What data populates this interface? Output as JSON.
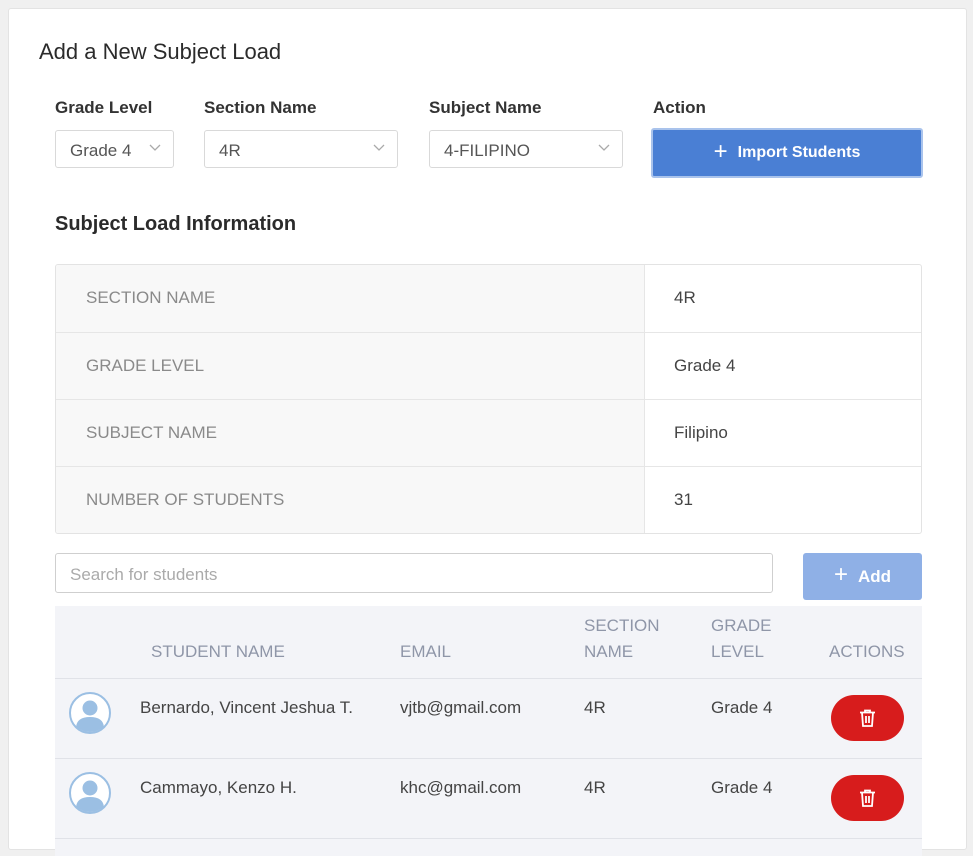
{
  "page_title": "Add a New Subject Load",
  "filters": {
    "grade_level": {
      "label": "Grade Level",
      "value": "Grade 4"
    },
    "section_name": {
      "label": "Section Name",
      "value": "4R"
    },
    "subject_name": {
      "label": "Subject Name",
      "value": "4-FILIPINO"
    },
    "action": {
      "label": "Action",
      "button": "Import Students"
    }
  },
  "info": {
    "heading": "Subject Load Information",
    "rows": [
      {
        "key": "SECTION NAME",
        "value": "4R"
      },
      {
        "key": "GRADE LEVEL",
        "value": "Grade 4"
      },
      {
        "key": "SUBJECT NAME",
        "value": "Filipino"
      },
      {
        "key": "NUMBER OF STUDENTS",
        "value": "31"
      }
    ]
  },
  "search": {
    "placeholder": "Search for students"
  },
  "add_button": "Add",
  "students_table": {
    "headers": {
      "name": "STUDENT NAME",
      "email": "EMAIL",
      "section_line1": "SECTION",
      "section_line2": "NAME",
      "grade_line1": "GRADE",
      "grade_line2": "LEVEL",
      "actions": "ACTIONS"
    },
    "rows": [
      {
        "name": "Bernardo, Vincent Jeshua T.",
        "email": "vjtb@gmail.com",
        "section": "4R",
        "grade": "Grade 4"
      },
      {
        "name": "Cammayo, Kenzo H.",
        "email": "khc@gmail.com",
        "section": "4R",
        "grade": "Grade 4"
      }
    ]
  },
  "colors": {
    "primary": "#4a7fd4",
    "primary_light": "#8fb0e6",
    "danger": "#d71c1c",
    "avatar": "#9bbfe3"
  },
  "icons": {
    "chevron": "chevron-down-icon",
    "plus": "plus-icon",
    "trash": "trash-icon",
    "avatar": "user-avatar-icon"
  }
}
